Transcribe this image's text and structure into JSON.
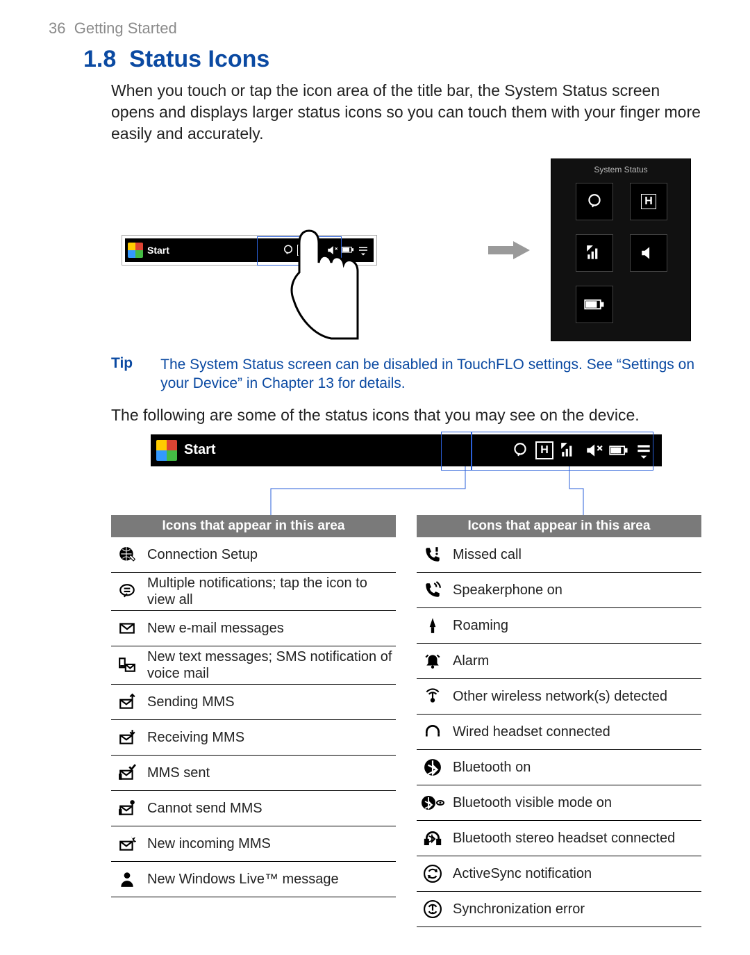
{
  "page": {
    "runhead_page": "36",
    "runhead_chapter": "Getting Started",
    "section_number": "1.8",
    "section_title": "Status Icons",
    "intro": "When you touch or tap the icon area of the title bar, the System Status screen opens and displays larger status icons so you can touch them with your finger more easily and accurately.",
    "tip_label": "Tip",
    "tip_text": "The System Status screen can be disabled in TouchFLO settings. See “Settings on your Device” in Chapter 13 for details.",
    "following": "The following are some of the status icons that you may see on the device."
  },
  "titlebar": {
    "start": "Start",
    "icons": [
      "notify",
      "H",
      "signal",
      "volume",
      "battery",
      "menu"
    ]
  },
  "system_status_panel": {
    "title": "System Status",
    "slots": [
      "notify",
      "H",
      "signal",
      "volume",
      "battery"
    ]
  },
  "tables": {
    "left": {
      "header": "Icons that appear in this area",
      "rows": [
        {
          "icon": "globe-wrench",
          "label": "Connection Setup"
        },
        {
          "icon": "bubble",
          "label": "Multiple notifications; tap the icon to view all"
        },
        {
          "icon": "envelope",
          "label": "New e-mail messages"
        },
        {
          "icon": "phone-envelope",
          "label": "New text messages; SMS notification of voice mail"
        },
        {
          "icon": "mms-up",
          "label": "Sending MMS"
        },
        {
          "icon": "mms-down",
          "label": "Receiving MMS"
        },
        {
          "icon": "mms-check",
          "label": "MMS sent"
        },
        {
          "icon": "mms-fail",
          "label": "Cannot send MMS"
        },
        {
          "icon": "mms-new",
          "label": "New incoming MMS"
        },
        {
          "icon": "person",
          "label": "New Windows Live™ message"
        }
      ]
    },
    "right": {
      "header": "Icons that appear in this area",
      "rows": [
        {
          "icon": "missed-call",
          "label": "Missed call"
        },
        {
          "icon": "speakerphone",
          "label": "Speakerphone on"
        },
        {
          "icon": "roaming",
          "label": "Roaming"
        },
        {
          "icon": "alarm",
          "label": "Alarm"
        },
        {
          "icon": "wifi-detected",
          "label": "Other wireless network(s) detected"
        },
        {
          "icon": "headset",
          "label": "Wired headset connected"
        },
        {
          "icon": "bluetooth",
          "label": "Bluetooth on"
        },
        {
          "icon": "bluetooth-visible",
          "label": "Bluetooth visible mode on"
        },
        {
          "icon": "bt-headset",
          "label": "Bluetooth stereo headset connected"
        },
        {
          "icon": "activesync",
          "label": "ActiveSync notification"
        },
        {
          "icon": "sync-error",
          "label": "Synchronization error"
        }
      ]
    }
  }
}
